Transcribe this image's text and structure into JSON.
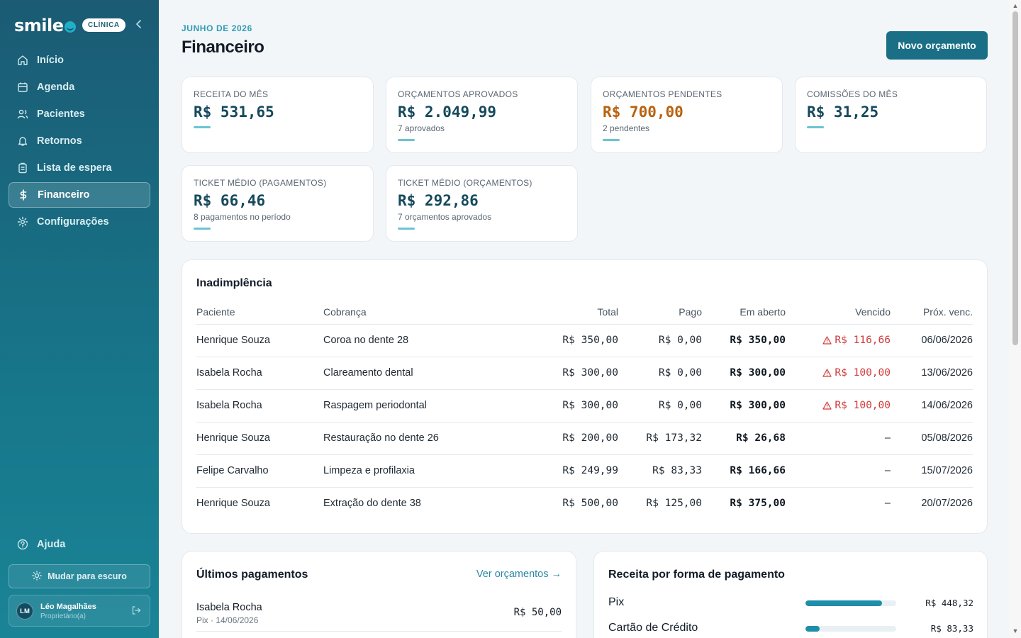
{
  "sidebar": {
    "logo": "smile",
    "badge": "CLÍNICA",
    "nav": [
      {
        "label": "Início",
        "icon": "home-icon",
        "active": false
      },
      {
        "label": "Agenda",
        "icon": "calendar-icon",
        "active": false
      },
      {
        "label": "Pacientes",
        "icon": "users-icon",
        "active": false
      },
      {
        "label": "Retornos",
        "icon": "bell-icon",
        "active": false
      },
      {
        "label": "Lista de espera",
        "icon": "clipboard-icon",
        "active": false
      },
      {
        "label": "Financeiro",
        "icon": "dollar-icon",
        "active": true
      },
      {
        "label": "Configurações",
        "icon": "gear-icon",
        "active": false
      }
    ],
    "help_label": "Ajuda",
    "dark_mode_label": "Mudar para escuro",
    "user": {
      "initials": "LM",
      "name": "Léo Magalhães",
      "role": "Proprietário(a)"
    }
  },
  "header": {
    "eyebrow": "JUNHO DE 2026",
    "title": "Financeiro",
    "primary_action": "Novo orçamento"
  },
  "kpis": [
    {
      "label": "RECEITA DO MÊS",
      "value": "R$ 531,65",
      "sub": "",
      "tone": "normal"
    },
    {
      "label": "ORÇAMENTOS APROVADOS",
      "value": "R$ 2.049,99",
      "sub": "7 aprovados",
      "tone": "normal"
    },
    {
      "label": "ORÇAMENTOS PENDENTES",
      "value": "R$ 700,00",
      "sub": "2 pendentes",
      "tone": "warning"
    },
    {
      "label": "COMISSÕES DO MÊS",
      "value": "R$ 31,25",
      "sub": "",
      "tone": "normal"
    },
    {
      "label": "TICKET MÉDIO (PAGAMENTOS)",
      "value": "R$ 66,46",
      "sub": "8 pagamentos no período",
      "tone": "normal"
    },
    {
      "label": "TICKET MÉDIO (ORÇAMENTOS)",
      "value": "R$ 292,86",
      "sub": "7 orçamentos aprovados",
      "tone": "normal"
    }
  ],
  "delinquency": {
    "title": "Inadimplência",
    "columns": [
      "Paciente",
      "Cobrança",
      "Total",
      "Pago",
      "Em aberto",
      "Vencido",
      "Próx. venc."
    ],
    "rows": [
      {
        "patient": "Henrique Souza",
        "charge": "Coroa no dente 28",
        "total": "R$ 350,00",
        "paid": "R$ 0,00",
        "open": "R$ 350,00",
        "overdue": "R$ 116,66",
        "next_due": "06/06/2026"
      },
      {
        "patient": "Isabela Rocha",
        "charge": "Clareamento dental",
        "total": "R$ 300,00",
        "paid": "R$ 0,00",
        "open": "R$ 300,00",
        "overdue": "R$ 100,00",
        "next_due": "13/06/2026"
      },
      {
        "patient": "Isabela Rocha",
        "charge": "Raspagem periodontal",
        "total": "R$ 300,00",
        "paid": "R$ 0,00",
        "open": "R$ 300,00",
        "overdue": "R$ 100,00",
        "next_due": "14/06/2026"
      },
      {
        "patient": "Henrique Souza",
        "charge": "Restauração no dente 26",
        "total": "R$ 200,00",
        "paid": "R$ 173,32",
        "open": "R$ 26,68",
        "overdue": "–",
        "next_due": "05/08/2026"
      },
      {
        "patient": "Felipe Carvalho",
        "charge": "Limpeza e profilaxia",
        "total": "R$ 249,99",
        "paid": "R$ 83,33",
        "open": "R$ 166,66",
        "overdue": "–",
        "next_due": "15/07/2026"
      },
      {
        "patient": "Henrique Souza",
        "charge": "Extração do dente 38",
        "total": "R$ 500,00",
        "paid": "R$ 125,00",
        "open": "R$ 375,00",
        "overdue": "–",
        "next_due": "20/07/2026"
      }
    ]
  },
  "payments": {
    "title": "Últimos pagamentos",
    "link": "Ver orçamentos →",
    "items": [
      {
        "name": "Isabela Rocha",
        "meta": "Pix · 14/06/2026",
        "amount": "R$ 50,00"
      }
    ]
  },
  "revenue_by_method": {
    "title": "Receita por forma de pagamento",
    "bar_color": "#1f8eaa",
    "items": [
      {
        "method": "Pix",
        "amount": "R$ 448,32",
        "share": 0.843
      },
      {
        "method": "Cartão de Crédito",
        "amount": "R$ 83,33",
        "share": 0.157
      }
    ]
  }
}
